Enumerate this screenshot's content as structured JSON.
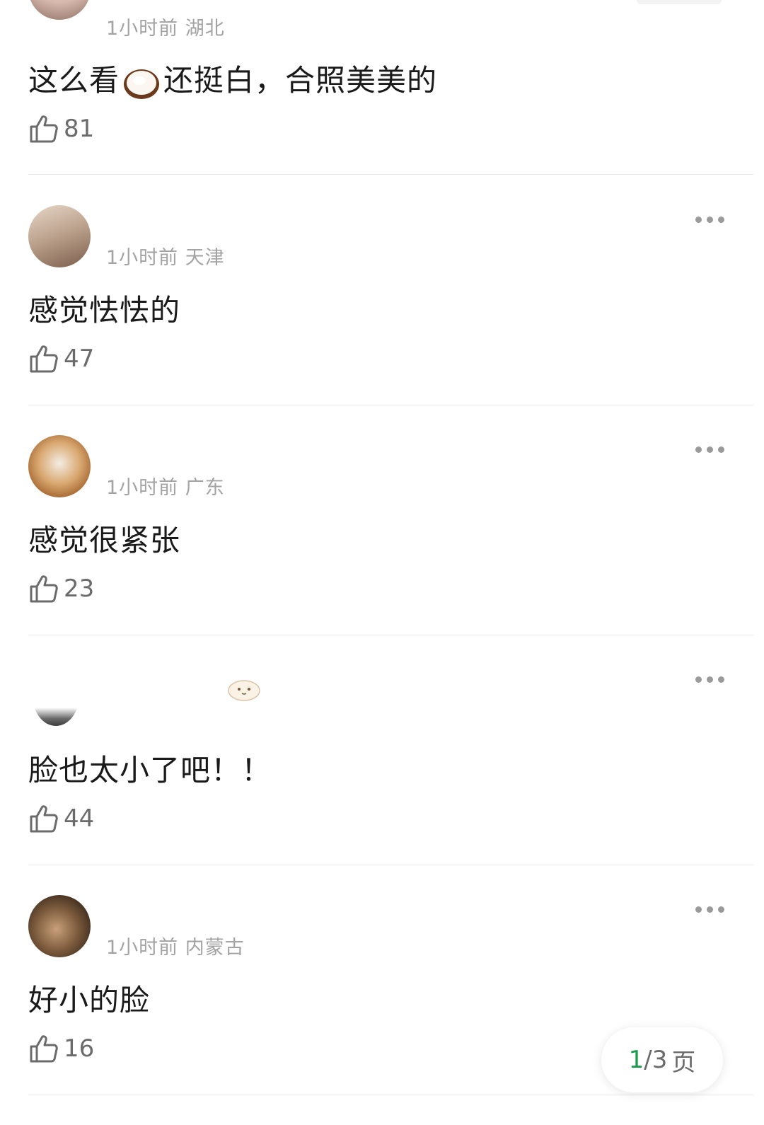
{
  "comments": [
    {
      "time": "1小时前",
      "region": "湖北",
      "text_before": "这么看",
      "text_after": "还挺白，合照美美的",
      "likes": "81"
    },
    {
      "time": "1小时前",
      "region": "天津",
      "text": "感觉怯怯的",
      "likes": "47"
    },
    {
      "time": "1小时前",
      "region": "广东",
      "text": "感觉很紧张",
      "likes": "23"
    },
    {
      "time": "",
      "region": "",
      "text": "脸也太小了吧！！",
      "likes": "44"
    },
    {
      "time": "1小时前",
      "region": "内蒙古",
      "text": "好小的脸",
      "likes": "16"
    }
  ],
  "pager": {
    "current": "1",
    "separator": "/",
    "total": "3",
    "unit": "页"
  },
  "icons": {
    "like": "thumbs-up-icon",
    "more": "more-options-icon",
    "emoji": "coconut-emoji"
  },
  "colors": {
    "accent": "#1d9a4e",
    "meta": "#a3a3a3",
    "divider": "#e8e8e8"
  }
}
